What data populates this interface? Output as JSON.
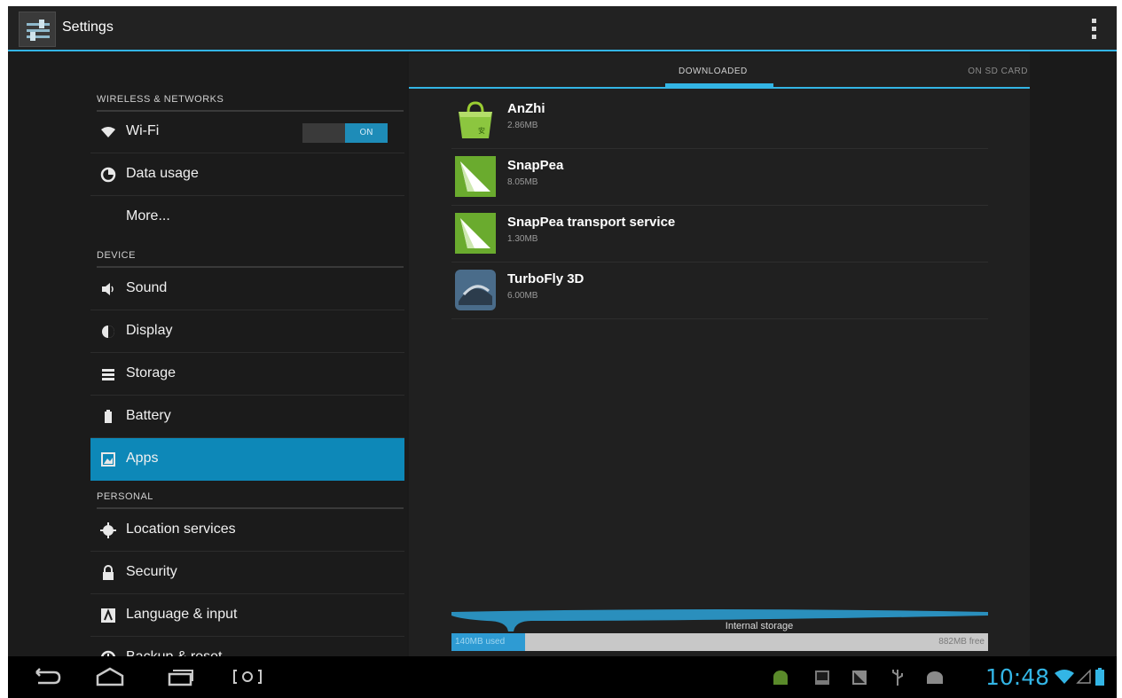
{
  "actionbar": {
    "title": "Settings"
  },
  "sidebar": {
    "categories": [
      "WIRELESS & NETWORKS",
      "DEVICE",
      "PERSONAL"
    ],
    "items": [
      {
        "label": "Wi-Fi",
        "icon": "wifi-icon",
        "toggle": "ON"
      },
      {
        "label": "Data usage",
        "icon": "data-usage-icon"
      },
      {
        "label": "More..."
      },
      {
        "label": "Sound",
        "icon": "sound-icon"
      },
      {
        "label": "Display",
        "icon": "display-icon"
      },
      {
        "label": "Storage",
        "icon": "storage-icon"
      },
      {
        "label": "Battery",
        "icon": "battery-icon"
      },
      {
        "label": "Apps",
        "icon": "apps-icon",
        "selected": true
      },
      {
        "label": "Location services",
        "icon": "location-icon"
      },
      {
        "label": "Security",
        "icon": "lock-icon"
      },
      {
        "label": "Language & input",
        "icon": "language-icon"
      },
      {
        "label": "Backup & reset",
        "icon": "backup-icon"
      }
    ]
  },
  "tabs": {
    "downloaded": "DOWNLOADED",
    "sd_card": "ON SD CARD"
  },
  "apps": [
    {
      "name": "AnZhi",
      "size": "2.86MB",
      "icon": "anzhi-bag-icon"
    },
    {
      "name": "SnapPea",
      "size": "8.05MB",
      "icon": "snappea-icon"
    },
    {
      "name": "SnapPea transport service",
      "size": "1.30MB",
      "icon": "snappea-icon"
    },
    {
      "name": "TurboFly 3D",
      "size": "6.00MB",
      "icon": "turbofly-icon"
    }
  ],
  "storage": {
    "label": "Internal storage",
    "used": "140MB used",
    "free": "882MB free",
    "used_fraction": 0.137
  },
  "statusbar": {
    "time": "10:48"
  },
  "colors": {
    "accent": "#33b5e5",
    "selected": "#0d88b8"
  }
}
